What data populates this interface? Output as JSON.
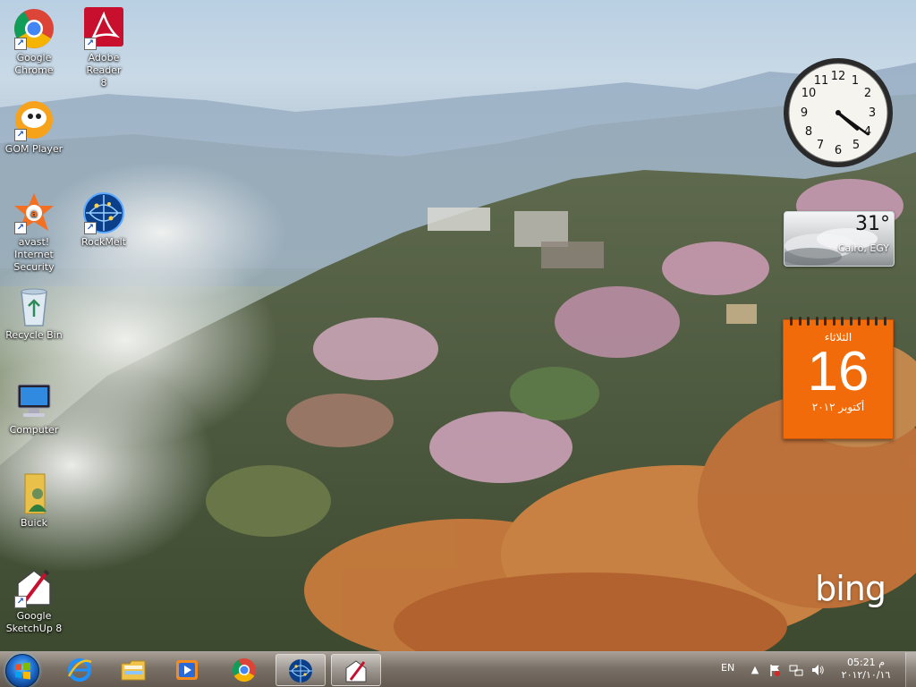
{
  "desktop": {
    "icons": [
      {
        "label": "Google\nChrome",
        "icon": "chrome-icon"
      },
      {
        "label": "Adobe Reader\n8",
        "icon": "adobe-reader-icon"
      },
      {
        "label": "GOM Player",
        "icon": "gom-player-icon"
      },
      {
        "label": "avast! Internet\nSecurity",
        "icon": "avast-icon"
      },
      {
        "label": "RockMelt",
        "icon": "rockmelt-icon"
      },
      {
        "label": "Recycle Bin",
        "icon": "recycle-bin-icon"
      },
      {
        "label": "Computer",
        "icon": "computer-icon"
      },
      {
        "label": "Buick",
        "icon": "user-folder-icon"
      },
      {
        "label": "Google\nSketchUp 8",
        "icon": "sketchup-icon"
      }
    ],
    "bing_logo": "bing"
  },
  "gadgets": {
    "clock": {
      "hour": 4,
      "minute": 21
    },
    "weather": {
      "temperature": "31°",
      "location": "Cairo, EGY"
    },
    "calendar": {
      "weekday": "الثلاثاء",
      "day": "16",
      "month_year": "أكتوبر ٢٠١٢"
    }
  },
  "taskbar": {
    "start_icon": "windows-orb-icon",
    "pinned": [
      {
        "name": "Internet Explorer",
        "icon": "ie-icon"
      },
      {
        "name": "Windows Explorer",
        "icon": "folder-icon"
      },
      {
        "name": "Windows Media Player",
        "icon": "media-player-icon"
      },
      {
        "name": "Google Chrome",
        "icon": "chrome-icon"
      },
      {
        "name": "RockMelt",
        "icon": "rockmelt-icon"
      },
      {
        "name": "Google SketchUp",
        "icon": "sketchup-icon"
      }
    ],
    "tray": {
      "language": "EN",
      "time": "05:21 م",
      "date": "٢٠١٢/١٠/١٦"
    }
  },
  "colors": {
    "calendar_orange": "#f26b0b",
    "taskbar": "#6e6458",
    "start_blue": "#1e6fd0"
  }
}
